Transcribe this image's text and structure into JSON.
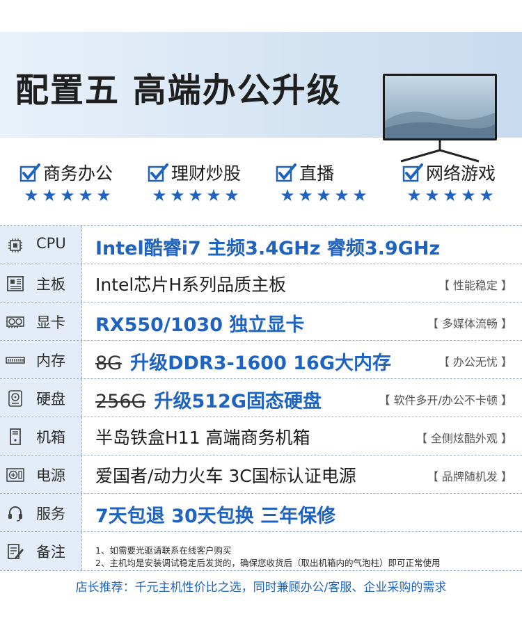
{
  "banner": {
    "title": "配置五  高端办公升级"
  },
  "features": [
    {
      "label": "商务办公",
      "stars": "★★★★★"
    },
    {
      "label": "理财炒股",
      "stars": "★★★★★"
    },
    {
      "label": "直播",
      "stars": "★★★★★"
    },
    {
      "label": "网络游戏",
      "stars": "★★★★★"
    }
  ],
  "specs": {
    "cpu": {
      "label": "CPU",
      "value": "Intel酷睿i7   主频3.4GHz  睿频3.9GHz"
    },
    "mainboard": {
      "label": "主板",
      "value": "Intel芯片H系列品质主板",
      "tag": "【 性能稳定 】"
    },
    "gpu": {
      "label": "显卡",
      "value": "RX550/1030 独立显卡",
      "tag": "【 多媒体流畅 】"
    },
    "memory": {
      "label": "内存",
      "old": "8G",
      "value": "升级DDR3-1600  16G大内存",
      "tag": "【 办公无忧 】"
    },
    "disk": {
      "label": "硬盘",
      "old": "256G",
      "value": "升级512G固态硬盘",
      "tag": "【 软件多开/办公不卡顿 】"
    },
    "case": {
      "label": "机箱",
      "value": "半岛铁盒H11 高端商务机箱",
      "tag": "【 全侧炫酷外观 】"
    },
    "psu": {
      "label": "电源",
      "value": "爱国者/动力火车 3C国标认证电源",
      "tag": "【 品牌随机发 】"
    },
    "service": {
      "label": "服务",
      "value": "7天包退   30天包换   三年保修"
    },
    "notes": {
      "label": "备注",
      "line1": "1、如需要光驱请联系在线客户购买",
      "line2": "2、主机均是安装调试稳定后发货的，确保您收货后（取出机箱内的气泡柱）即可正常使用"
    }
  },
  "footer": {
    "text": "店长推荐：千元主机性价比之选，同时兼顾办公/客服、企业采购的需求"
  },
  "colors": {
    "accent": "#1f63c0",
    "label_bg": "#e4edf7",
    "banner_bg": "#d5e4f3"
  },
  "icons": [
    "check-icon",
    "star-icon",
    "cpu-icon",
    "mainboard-icon",
    "graphics-card-icon",
    "memory-icon",
    "hard-disk-icon",
    "pc-case-icon",
    "power-supply-icon",
    "headset-icon",
    "note-edit-icon"
  ]
}
